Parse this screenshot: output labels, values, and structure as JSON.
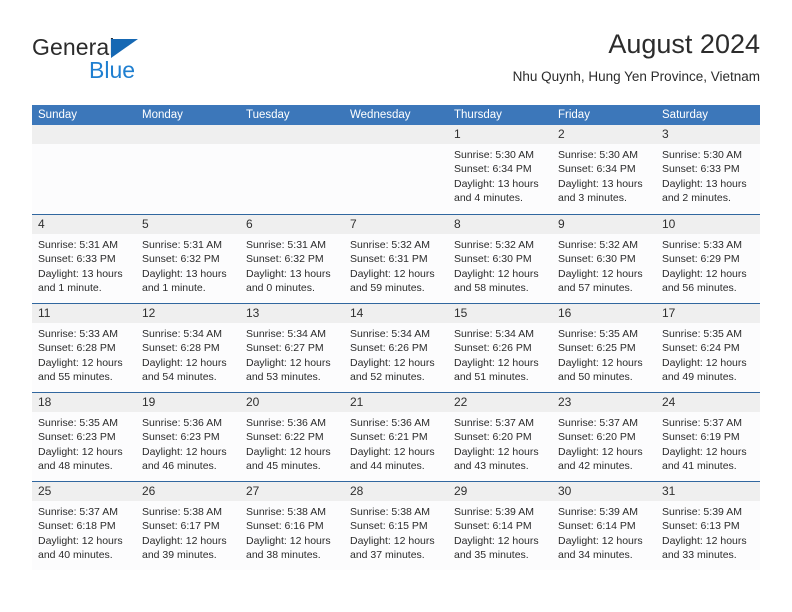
{
  "brand": {
    "name_part1": "General",
    "name_part2": "Blue",
    "triangle_color": "#1668b3",
    "blue_color": "#1f7fd0"
  },
  "header": {
    "title": "August 2024",
    "subtitle": "Nhu Quynh, Hung Yen Province, Vietnam"
  },
  "theme": {
    "header_bar_color": "#3c77ba",
    "row_rule_color": "#31679f",
    "day_band_color": "#efefef",
    "cell_background": "#fcfcfd",
    "text_color": "#2b2b2b"
  },
  "weekdays": [
    "Sunday",
    "Monday",
    "Tuesday",
    "Wednesday",
    "Thursday",
    "Friday",
    "Saturday"
  ],
  "weeks": [
    [
      {
        "day": "",
        "empty": true,
        "sunrise": "",
        "sunset": "",
        "daylight_1": "",
        "daylight_2": ""
      },
      {
        "day": "",
        "empty": true,
        "sunrise": "",
        "sunset": "",
        "daylight_1": "",
        "daylight_2": ""
      },
      {
        "day": "",
        "empty": true,
        "sunrise": "",
        "sunset": "",
        "daylight_1": "",
        "daylight_2": ""
      },
      {
        "day": "",
        "empty": true,
        "sunrise": "",
        "sunset": "",
        "daylight_1": "",
        "daylight_2": ""
      },
      {
        "day": "1",
        "empty": false,
        "sunrise": "Sunrise: 5:30 AM",
        "sunset": "Sunset: 6:34 PM",
        "daylight_1": "Daylight: 13 hours",
        "daylight_2": "and 4 minutes."
      },
      {
        "day": "2",
        "empty": false,
        "sunrise": "Sunrise: 5:30 AM",
        "sunset": "Sunset: 6:34 PM",
        "daylight_1": "Daylight: 13 hours",
        "daylight_2": "and 3 minutes."
      },
      {
        "day": "3",
        "empty": false,
        "sunrise": "Sunrise: 5:30 AM",
        "sunset": "Sunset: 6:33 PM",
        "daylight_1": "Daylight: 13 hours",
        "daylight_2": "and 2 minutes."
      }
    ],
    [
      {
        "day": "4",
        "empty": false,
        "sunrise": "Sunrise: 5:31 AM",
        "sunset": "Sunset: 6:33 PM",
        "daylight_1": "Daylight: 13 hours",
        "daylight_2": "and 1 minute."
      },
      {
        "day": "5",
        "empty": false,
        "sunrise": "Sunrise: 5:31 AM",
        "sunset": "Sunset: 6:32 PM",
        "daylight_1": "Daylight: 13 hours",
        "daylight_2": "and 1 minute."
      },
      {
        "day": "6",
        "empty": false,
        "sunrise": "Sunrise: 5:31 AM",
        "sunset": "Sunset: 6:32 PM",
        "daylight_1": "Daylight: 13 hours",
        "daylight_2": "and 0 minutes."
      },
      {
        "day": "7",
        "empty": false,
        "sunrise": "Sunrise: 5:32 AM",
        "sunset": "Sunset: 6:31 PM",
        "daylight_1": "Daylight: 12 hours",
        "daylight_2": "and 59 minutes."
      },
      {
        "day": "8",
        "empty": false,
        "sunrise": "Sunrise: 5:32 AM",
        "sunset": "Sunset: 6:30 PM",
        "daylight_1": "Daylight: 12 hours",
        "daylight_2": "and 58 minutes."
      },
      {
        "day": "9",
        "empty": false,
        "sunrise": "Sunrise: 5:32 AM",
        "sunset": "Sunset: 6:30 PM",
        "daylight_1": "Daylight: 12 hours",
        "daylight_2": "and 57 minutes."
      },
      {
        "day": "10",
        "empty": false,
        "sunrise": "Sunrise: 5:33 AM",
        "sunset": "Sunset: 6:29 PM",
        "daylight_1": "Daylight: 12 hours",
        "daylight_2": "and 56 minutes."
      }
    ],
    [
      {
        "day": "11",
        "empty": false,
        "sunrise": "Sunrise: 5:33 AM",
        "sunset": "Sunset: 6:28 PM",
        "daylight_1": "Daylight: 12 hours",
        "daylight_2": "and 55 minutes."
      },
      {
        "day": "12",
        "empty": false,
        "sunrise": "Sunrise: 5:34 AM",
        "sunset": "Sunset: 6:28 PM",
        "daylight_1": "Daylight: 12 hours",
        "daylight_2": "and 54 minutes."
      },
      {
        "day": "13",
        "empty": false,
        "sunrise": "Sunrise: 5:34 AM",
        "sunset": "Sunset: 6:27 PM",
        "daylight_1": "Daylight: 12 hours",
        "daylight_2": "and 53 minutes."
      },
      {
        "day": "14",
        "empty": false,
        "sunrise": "Sunrise: 5:34 AM",
        "sunset": "Sunset: 6:26 PM",
        "daylight_1": "Daylight: 12 hours",
        "daylight_2": "and 52 minutes."
      },
      {
        "day": "15",
        "empty": false,
        "sunrise": "Sunrise: 5:34 AM",
        "sunset": "Sunset: 6:26 PM",
        "daylight_1": "Daylight: 12 hours",
        "daylight_2": "and 51 minutes."
      },
      {
        "day": "16",
        "empty": false,
        "sunrise": "Sunrise: 5:35 AM",
        "sunset": "Sunset: 6:25 PM",
        "daylight_1": "Daylight: 12 hours",
        "daylight_2": "and 50 minutes."
      },
      {
        "day": "17",
        "empty": false,
        "sunrise": "Sunrise: 5:35 AM",
        "sunset": "Sunset: 6:24 PM",
        "daylight_1": "Daylight: 12 hours",
        "daylight_2": "and 49 minutes."
      }
    ],
    [
      {
        "day": "18",
        "empty": false,
        "sunrise": "Sunrise: 5:35 AM",
        "sunset": "Sunset: 6:23 PM",
        "daylight_1": "Daylight: 12 hours",
        "daylight_2": "and 48 minutes."
      },
      {
        "day": "19",
        "empty": false,
        "sunrise": "Sunrise: 5:36 AM",
        "sunset": "Sunset: 6:23 PM",
        "daylight_1": "Daylight: 12 hours",
        "daylight_2": "and 46 minutes."
      },
      {
        "day": "20",
        "empty": false,
        "sunrise": "Sunrise: 5:36 AM",
        "sunset": "Sunset: 6:22 PM",
        "daylight_1": "Daylight: 12 hours",
        "daylight_2": "and 45 minutes."
      },
      {
        "day": "21",
        "empty": false,
        "sunrise": "Sunrise: 5:36 AM",
        "sunset": "Sunset: 6:21 PM",
        "daylight_1": "Daylight: 12 hours",
        "daylight_2": "and 44 minutes."
      },
      {
        "day": "22",
        "empty": false,
        "sunrise": "Sunrise: 5:37 AM",
        "sunset": "Sunset: 6:20 PM",
        "daylight_1": "Daylight: 12 hours",
        "daylight_2": "and 43 minutes."
      },
      {
        "day": "23",
        "empty": false,
        "sunrise": "Sunrise: 5:37 AM",
        "sunset": "Sunset: 6:20 PM",
        "daylight_1": "Daylight: 12 hours",
        "daylight_2": "and 42 minutes."
      },
      {
        "day": "24",
        "empty": false,
        "sunrise": "Sunrise: 5:37 AM",
        "sunset": "Sunset: 6:19 PM",
        "daylight_1": "Daylight: 12 hours",
        "daylight_2": "and 41 minutes."
      }
    ],
    [
      {
        "day": "25",
        "empty": false,
        "sunrise": "Sunrise: 5:37 AM",
        "sunset": "Sunset: 6:18 PM",
        "daylight_1": "Daylight: 12 hours",
        "daylight_2": "and 40 minutes."
      },
      {
        "day": "26",
        "empty": false,
        "sunrise": "Sunrise: 5:38 AM",
        "sunset": "Sunset: 6:17 PM",
        "daylight_1": "Daylight: 12 hours",
        "daylight_2": "and 39 minutes."
      },
      {
        "day": "27",
        "empty": false,
        "sunrise": "Sunrise: 5:38 AM",
        "sunset": "Sunset: 6:16 PM",
        "daylight_1": "Daylight: 12 hours",
        "daylight_2": "and 38 minutes."
      },
      {
        "day": "28",
        "empty": false,
        "sunrise": "Sunrise: 5:38 AM",
        "sunset": "Sunset: 6:15 PM",
        "daylight_1": "Daylight: 12 hours",
        "daylight_2": "and 37 minutes."
      },
      {
        "day": "29",
        "empty": false,
        "sunrise": "Sunrise: 5:39 AM",
        "sunset": "Sunset: 6:14 PM",
        "daylight_1": "Daylight: 12 hours",
        "daylight_2": "and 35 minutes."
      },
      {
        "day": "30",
        "empty": false,
        "sunrise": "Sunrise: 5:39 AM",
        "sunset": "Sunset: 6:14 PM",
        "daylight_1": "Daylight: 12 hours",
        "daylight_2": "and 34 minutes."
      },
      {
        "day": "31",
        "empty": false,
        "sunrise": "Sunrise: 5:39 AM",
        "sunset": "Sunset: 6:13 PM",
        "daylight_1": "Daylight: 12 hours",
        "daylight_2": "and 33 minutes."
      }
    ]
  ]
}
